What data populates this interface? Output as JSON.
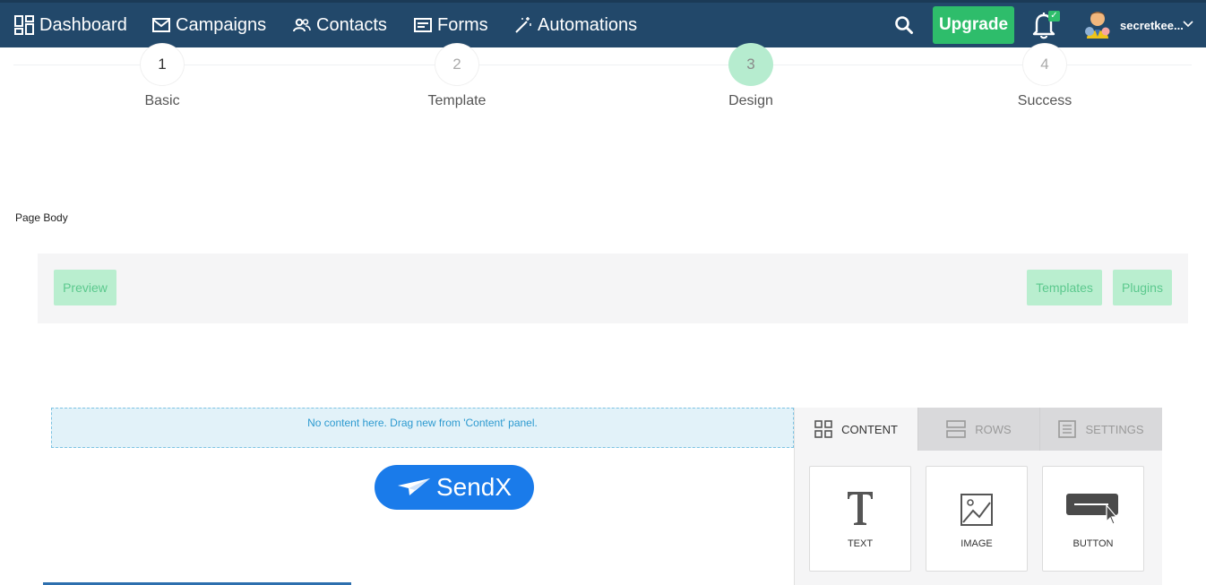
{
  "nav": {
    "dashboard": "Dashboard",
    "campaigns": "Campaigns",
    "contacts": "Contacts",
    "forms": "Forms",
    "automations": "Automations",
    "upgrade": "Upgrade",
    "username": "secretkee..."
  },
  "steps": [
    {
      "number": "1",
      "label": "Basic"
    },
    {
      "number": "2",
      "label": "Template"
    },
    {
      "number": "3",
      "label": "Design"
    },
    {
      "number": "4",
      "label": "Success"
    }
  ],
  "page_body_label": "Page Body",
  "toolbar": {
    "preview": "Preview",
    "templates": "Templates",
    "plugins": "Plugins"
  },
  "editor": {
    "dropzone_text": "No content here. Drag new from 'Content' panel.",
    "logo_text": "SendX"
  },
  "panel": {
    "tabs": {
      "content": "CONTENT",
      "rows": "ROWS",
      "settings": "SETTINGS"
    },
    "blocks": {
      "text": "TEXT",
      "image": "IMAGE",
      "button": "BUTTON"
    }
  },
  "colors": {
    "nav_bg": "#22486a",
    "upgrade_bg": "#2ebd6b",
    "active_step": "#b6eccf",
    "logo_bg": "#1a7bea"
  }
}
